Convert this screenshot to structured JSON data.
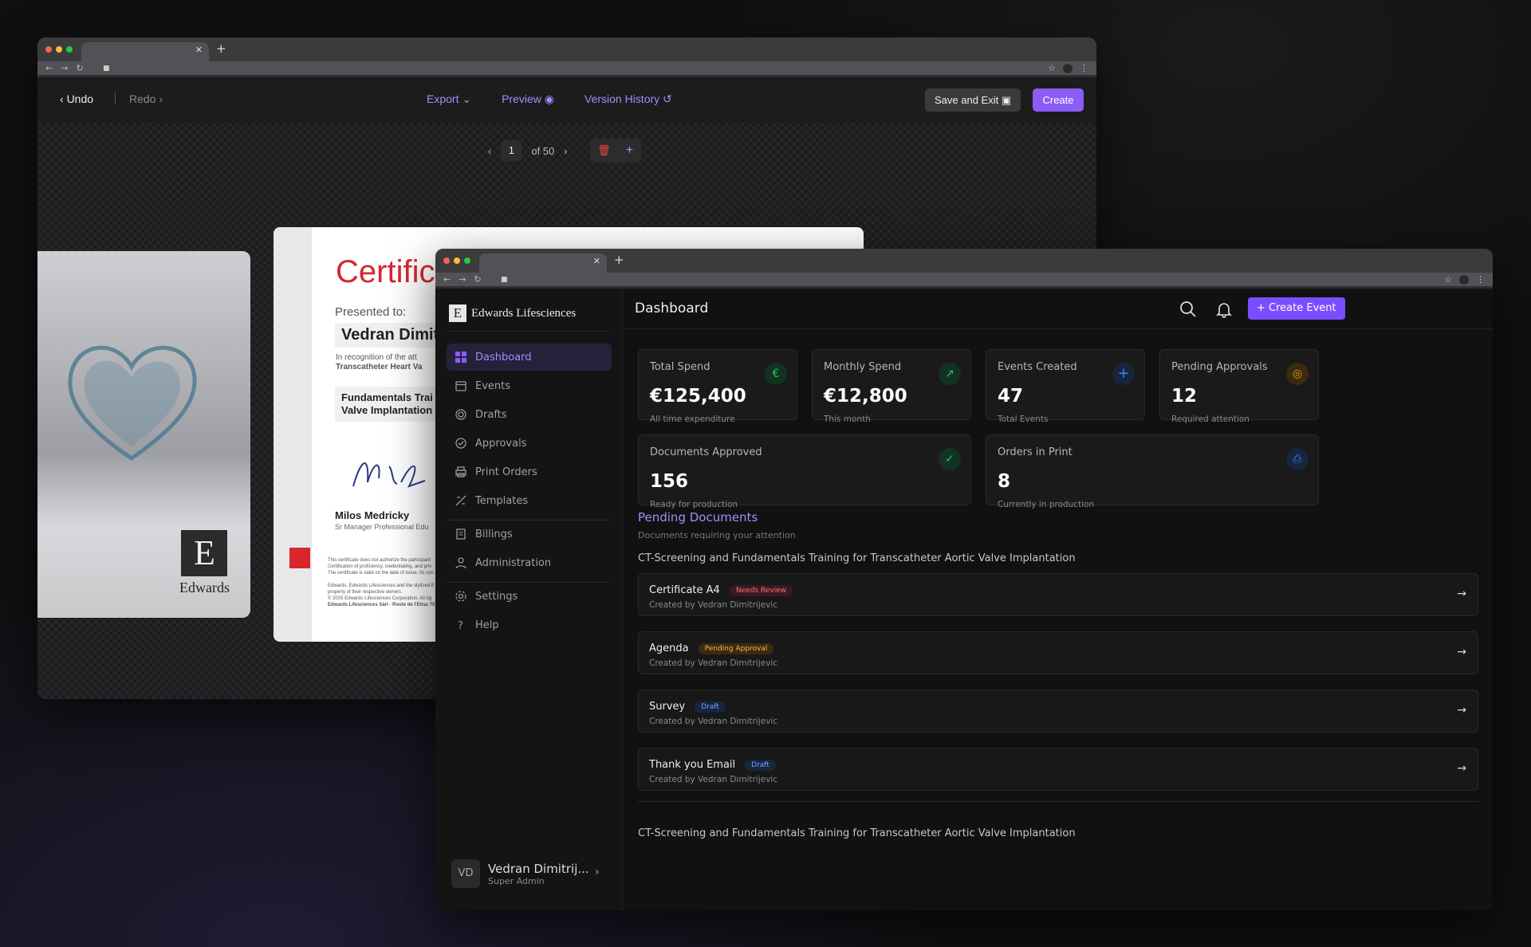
{
  "editor": {
    "undo": "Undo",
    "redo": "Redo",
    "export": "Export",
    "preview": "Preview",
    "version_history": "Version History",
    "save_exit": "Save and Exit",
    "create": "Create",
    "page_current": "1",
    "page_total": "of 50",
    "cert": {
      "title": "Certifica",
      "presented": "Presented to:",
      "name": "Vedran Dimit",
      "recognition": "In recognition of the att",
      "course_line": "Transcatheter Heart Va",
      "program": "Fundamentals Trai",
      "program2": "Valve Implantation",
      "signer": "Milos Medricky",
      "signer_role": "Sr Manager Professional Edu",
      "fine1": "This certificate does not authorize the participant",
      "fine2": "Certification of proficiency, credentialing, and priv",
      "fine3": "The certificate is valid on the date of issue. Its con",
      "fine4": "Edwards, Edwards Lifesciences and the stylized E l",
      "fine5": "property of their respective owners.",
      "fine6": "© 2025 Edwards Lifesciences Corporation. All rig",
      "fine7": "Edwards Lifesciences Sàrl · Route de l'Etraz 70"
    },
    "card_left": {
      "brand": "Edwards",
      "logo_letter": "E"
    }
  },
  "dashboard": {
    "brand": "Edwards Lifesciences",
    "logo_letter": "E",
    "page_title": "Dashboard",
    "create_event": "Create Event",
    "nav": [
      {
        "label": "Dashboard"
      },
      {
        "label": "Events"
      },
      {
        "label": "Drafts"
      },
      {
        "label": "Approvals"
      },
      {
        "label": "Print Orders"
      },
      {
        "label": "Templates"
      },
      {
        "label": "Billings"
      },
      {
        "label": "Administration"
      },
      {
        "label": "Settings"
      },
      {
        "label": "Help"
      }
    ],
    "user": {
      "initials": "VD",
      "name": "Vedran Dimitrij...",
      "role": "Super Admin"
    },
    "stats": [
      {
        "label": "Total Spend",
        "value": "€125,400",
        "sub": "All time expenditure",
        "icon": "euro-icon",
        "color": "#22c55e"
      },
      {
        "label": "Monthly Spend",
        "value": "€12,800",
        "sub": "This month",
        "icon": "trend-up-icon",
        "color": "#22c55e"
      },
      {
        "label": "Events Created",
        "value": "47",
        "sub": "Total Events",
        "icon": "plus-icon",
        "color": "#3b82f6"
      },
      {
        "label": "Pending Approvals",
        "value": "12",
        "sub": "Required attention",
        "icon": "target-icon",
        "color": "#f59e0b"
      },
      {
        "label": "Documents Approved",
        "value": "156",
        "sub": "Ready for production",
        "icon": "check-circle-icon",
        "color": "#22c55e"
      },
      {
        "label": "Orders in Print",
        "value": "8",
        "sub": "Currently in production",
        "icon": "printer-icon",
        "color": "#3b82f6"
      }
    ],
    "pending_title": "Pending Documents",
    "pending_sub": "Documents requiring your attention",
    "group1": "CT-Screening and Fundamentals Training for Transcatheter Aortic Valve Implantation",
    "group2": "CT-Screening and Fundamentals Training for Transcatheter Aortic Valve Implantation",
    "docs": [
      {
        "name": "Certificate A4",
        "badge": "Needs Review",
        "by": "Created by Vedran Dimitrijevic"
      },
      {
        "name": "Agenda",
        "badge": "Pending Approval",
        "by": "Created by Vedran Dimitrijevic"
      },
      {
        "name": "Survey",
        "badge": "Draft",
        "by": "Created by Vedran Dimitrijevic"
      },
      {
        "name": "Thank you Email",
        "badge": "Draft",
        "by": "Created by Vedran Dimitrijevic"
      }
    ]
  }
}
